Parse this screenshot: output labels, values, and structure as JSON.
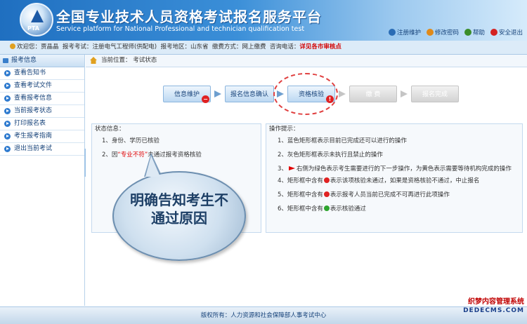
{
  "header": {
    "logo_text": "PTA",
    "title_cn": "全国专业技术人员资格考试报名服务平台",
    "title_en": "Service platform for National Professional and technician qualification test",
    "links": [
      {
        "label": "注册维护",
        "icon": "register-icon",
        "color": "#2a6cb5"
      },
      {
        "label": "修改密码",
        "icon": "key-icon",
        "color": "#e08a1a"
      },
      {
        "label": "帮助",
        "icon": "help-icon",
        "color": "#3a8d2a"
      },
      {
        "label": "安全退出",
        "icon": "logout-icon",
        "color": "#d42222"
      }
    ]
  },
  "infobar": {
    "welcome": "欢迎您：贾晶晶",
    "exam_label": "报考考试：",
    "exam_value": "注册电气工程师(供配电)",
    "region_label": "报考地区：",
    "region_value": "山东省",
    "pay_label": "缴费方式：",
    "pay_value": "网上缴费",
    "phone_label": "咨询电话：",
    "phone_value": "详见各市审核点"
  },
  "sidebar": {
    "header": "报考信息",
    "items": [
      "查看告知书",
      "查看考试文件",
      "查看报考信息",
      "当前报考状态",
      "打印报名表",
      "考生报考指南",
      "退出当前考试"
    ]
  },
  "breadcrumb": {
    "label": "当前位置：",
    "current": "考试状态"
  },
  "steps": [
    {
      "label": "信息维护",
      "state": "done",
      "badge": "minus"
    },
    {
      "label": "报名信息确认",
      "state": "done",
      "badge": ""
    },
    {
      "label": "资格核验",
      "state": "done",
      "badge": "!"
    },
    {
      "label": "缴 费",
      "state": "gray",
      "badge": ""
    },
    {
      "label": "报名完成",
      "state": "gray",
      "badge": ""
    }
  ],
  "status_panel": {
    "title": "状态信息：",
    "line1": "1、身份、学历已核验",
    "line2_pre": "2、因",
    "line2_red": "“专业不符”",
    "line2_post": "未通过报考资格核验"
  },
  "tips_panel": {
    "title": "操作提示：",
    "tip1": "1、蓝色矩形框表示目前已完成还可以进行的操作",
    "tip2": "2、灰色矩形框表示未执行且禁止的操作",
    "tip3_pre": "3、",
    "tip3_post": "右侧为绿色表示考生需要进行的下一步操作，为黄色表示需要等待机构完成的操作",
    "tip4_pre": "4、矩形框中含有",
    "tip4_post": "表示该项核验未通过，如果是资格核验不通过，中止报名",
    "tip5_pre": "5、矩形框中含有",
    "tip5_post": "表示报考人员当前已完成不可再进行此项操作",
    "tip6_pre": "6、矩形框中含有",
    "tip6_post": "表示核验通过"
  },
  "callout": {
    "text": "明确告知考生不通过原因"
  },
  "footer": {
    "text": "版权所有：人力资源和社会保障部人事考试中心"
  },
  "watermark": {
    "line1": "织梦内容管理系统",
    "line2": "DEDECMS.COM"
  }
}
